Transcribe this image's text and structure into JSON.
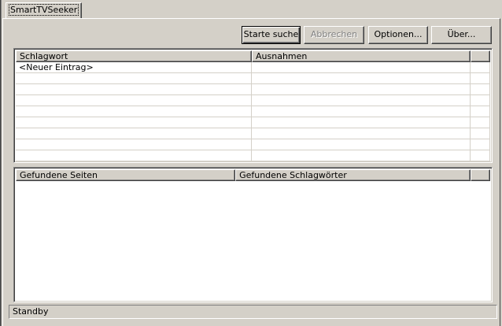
{
  "tab": {
    "label": "SmartTVSeeker"
  },
  "toolbar": {
    "start_label": "Starte suche",
    "cancel_label": "Abbrechen",
    "options_label": "Optionen...",
    "about_label": "Über..."
  },
  "keywords_table": {
    "columns": [
      "Schlagwort",
      "Ausnahmen",
      ""
    ],
    "rows": [
      [
        "<Neuer Eintrag>",
        "",
        ""
      ],
      [
        "",
        "",
        ""
      ],
      [
        "",
        "",
        ""
      ],
      [
        "",
        "",
        ""
      ],
      [
        "",
        "",
        ""
      ],
      [
        "",
        "",
        ""
      ],
      [
        "",
        "",
        ""
      ],
      [
        "",
        "",
        ""
      ],
      [
        "",
        "",
        ""
      ],
      [
        "",
        "",
        ""
      ],
      [
        "",
        "",
        ""
      ],
      [
        "",
        "",
        ""
      ]
    ]
  },
  "results_table": {
    "columns": [
      "Gefundene Seiten",
      "Gefundene Schlagwörter",
      ""
    ],
    "rows": []
  },
  "status": {
    "text": "Standby"
  }
}
